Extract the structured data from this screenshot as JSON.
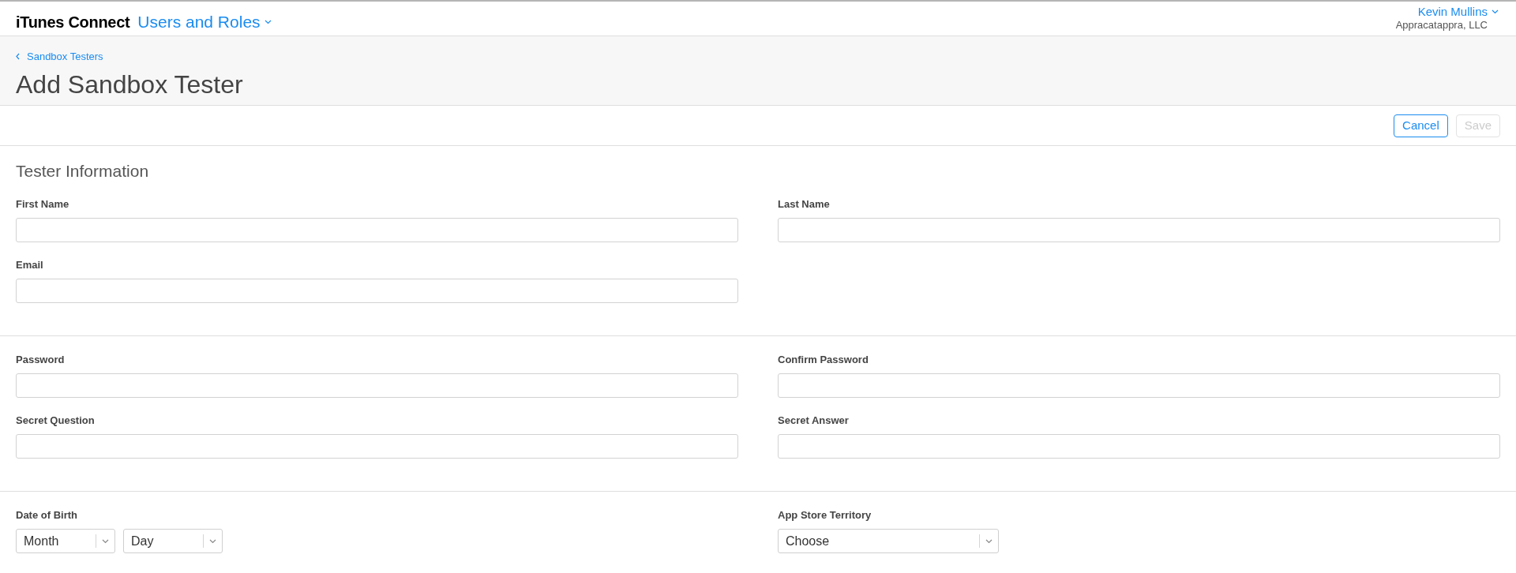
{
  "header": {
    "brand": "iTunes Connect",
    "section_menu": "Users and Roles",
    "user_name": "Kevin Mullins",
    "organization": "Appracatappra, LLC"
  },
  "breadcrumb": "Sandbox Testers",
  "page_title": "Add Sandbox Tester",
  "buttons": [
    {
      "label": "Cancel",
      "disabled": false
    },
    {
      "label": "Save",
      "disabled": true
    }
  ],
  "sections": [
    {
      "title": "Tester Information",
      "fields": [
        {
          "label": "First Name",
          "kind": "text"
        },
        {
          "label": "Last Name",
          "kind": "text"
        },
        {
          "label": "Email",
          "kind": "text"
        }
      ]
    },
    {
      "fields": [
        {
          "label": "Password",
          "kind": "text"
        },
        {
          "label": "Confirm Password",
          "kind": "text"
        },
        {
          "label": "Secret Question",
          "kind": "text"
        },
        {
          "label": "Secret Answer",
          "kind": "text"
        }
      ]
    },
    {
      "fields": [
        {
          "label": "Date of Birth",
          "kind": "selects",
          "selects": [
            {
              "value": "Month"
            },
            {
              "value": "Day"
            }
          ]
        },
        {
          "label": "App Store Territory",
          "kind": "selects",
          "selects": [
            {
              "value": "Choose"
            }
          ]
        }
      ]
    }
  ]
}
